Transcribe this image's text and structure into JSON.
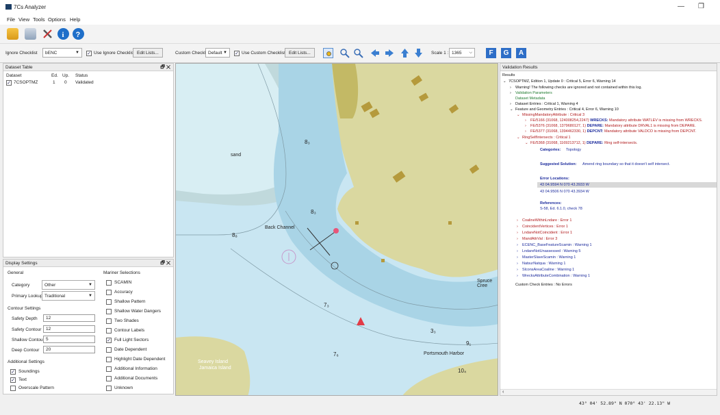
{
  "app": {
    "title": "7Cs Analyzer",
    "minimize": "—",
    "restore": "❐"
  },
  "menu": [
    "File",
    "View",
    "Tools",
    "Options",
    "Help"
  ],
  "toolbar2": {
    "ignore_label": "Ignore Checklist",
    "ignore_value": "bENC",
    "use_ignore": "Use Ignore Checklist",
    "edit_lists": "Edit Lists...",
    "custom_label": "Custom Checklist",
    "custom_value": "Default",
    "use_custom": "Use Custom Checklist",
    "edit_lists2": "Edit Lists...",
    "scale_label": "Scale 1 :",
    "scale_value": "1365",
    "btn_f": "F",
    "btn_g": "G",
    "btn_a": "A"
  },
  "dataset_table": {
    "title": "Dataset Table",
    "headers": [
      "Dataset",
      "Ed.",
      "Up.",
      "Status"
    ],
    "rows": [
      {
        "dataset": "7CSOPTMZ",
        "ed": "1",
        "up": "0",
        "status": "Validated"
      }
    ]
  },
  "display_settings": {
    "title": "Display Settings",
    "general": "General",
    "category_label": "Category",
    "category_value": "Other",
    "lookup_label": "Primary Lookup",
    "lookup_value": "Traditional",
    "contour_title": "Contour Settings",
    "safety_depth_label": "Safety Depth",
    "safety_depth": "12",
    "safety_contour_label": "Safety Contour",
    "safety_contour": "12",
    "shallow_contour_label": "Shallow Contour",
    "shallow_contour": "5",
    "deep_contour_label": "Deep Contour",
    "deep_contour": "20",
    "additional_title": "Additional Settings",
    "soundings": "Soundings",
    "text": "Text",
    "overscale": "Overscale Pattern",
    "mariner_title": "Mariner Selections",
    "mariner": [
      {
        "label": "SCAMIN",
        "checked": false
      },
      {
        "label": "Accuracy",
        "checked": false
      },
      {
        "label": "Shallow Pattern",
        "checked": false
      },
      {
        "label": "Shallow Water Dangers",
        "checked": false
      },
      {
        "label": "Two Shades",
        "checked": false
      },
      {
        "label": "Contour Labels",
        "checked": false
      },
      {
        "label": "Full Light Sectors",
        "checked": true
      },
      {
        "label": "Date Dependent",
        "checked": false
      },
      {
        "label": "Highlight Date Dependent",
        "checked": false
      },
      {
        "label": "Additional Information",
        "checked": false
      },
      {
        "label": "Additional Documents",
        "checked": false
      },
      {
        "label": "Unknown",
        "checked": false
      }
    ]
  },
  "map": {
    "labels": {
      "sand": "sand",
      "back_channel": "Back Channel",
      "spruce_creek": "Spruce Cree",
      "portsmouth": "Portsmouth Harbor",
      "seavey": "Seavey Island",
      "jamaica": "Jamaica Island"
    },
    "depths": {
      "d1": "8₃",
      "d2": "8₃",
      "d3": "8₈",
      "d4": "7₃",
      "d5": "3₃",
      "d6": "9₁",
      "d7": "7₆",
      "d8": "10₄"
    }
  },
  "validation": {
    "title": "Validation Results",
    "results_label": "Results",
    "summary": "7CSOPTMZ, Edition 1, Update 0 : Critical 5, Error 6, Warning 14",
    "warning_line": "Warning! The following checks are ignored and not contained within this log.",
    "validation_params": "Validation Parameters",
    "dataset_metadata": "Dataset Metadata",
    "dataset_entries": "Dataset Entries : Critical 1, Warning 4",
    "feature_entries": "Feature and Geometry Entries : Critical 4, Error 6, Warning 10",
    "missing_attr": "MissingMandatoryAttribute : Critical 3",
    "fe1_ref": "FE/5166 (31068, 124008254,2247)",
    "fe1_key": "WRECKS:",
    "fe1_msg": "Mandatory attribute WATLEV is missing from WRECKS.",
    "fe2_ref": "FE/5376 (31068, 1379680127, 1)",
    "fe2_key": "DEPARE:",
    "fe2_msg": "Mandatory attribute DRVAL1 is missing from DEPARE.",
    "fe3_ref": "FE/5377 (31068, 1394462330, 1)",
    "fe3_key": "DEPCNT:",
    "fe3_msg": "Mandatory attribute VALDCO is missing from DEPCNT.",
    "ring_self": "RingSelfIntersects : Critical 1",
    "fe4_ref": "FE/5368 (31068, 1169213712, 1)",
    "fe4_key": "DEPARE:",
    "fe4_msg": "Ring self-intersects.",
    "categories_label": "Categories:",
    "categories_value": "Topology",
    "suggested_label": "Suggested Solution:",
    "suggested_value": "Amend ring boundary so that it doesn't self intersect.",
    "error_loc_label": "Error Locations:",
    "loc1": "43 04.9594 N 070 43.3933 W",
    "loc2": "43 04.9506 N 070 43.3934 W",
    "references_label": "References:",
    "references_value": "S-58, Ed. 6.1.0, check 78",
    "errors": [
      {
        "text": "CoalineWithinLndare : Error 1",
        "color": "red"
      },
      {
        "text": "CoincidentVertices : Error 1",
        "color": "red"
      },
      {
        "text": "LndareNotCoincident : Error 1",
        "color": "red"
      },
      {
        "text": "MandAttrVal : Error 3",
        "color": "red"
      },
      {
        "text": "ECENC_BaseFeatureScamin : Warning 1",
        "color": "blue"
      },
      {
        "text": "LndareNotUnassessed : Warning 5",
        "color": "blue"
      },
      {
        "text": "MasterSlaveScamin : Warning 1",
        "color": "blue"
      },
      {
        "text": "NatsurNatqua : Warning 1",
        "color": "blue"
      },
      {
        "text": "SlconsAreaCoaline : Warning 1",
        "color": "blue"
      },
      {
        "text": "WrecksAttributeCombination : Warning 1",
        "color": "blue"
      }
    ],
    "custom_entries": "Custom Check Entries : No Errors"
  },
  "status": {
    "coords": "43° 04' 52.89\" N  070° 43' 22.13\" W"
  }
}
